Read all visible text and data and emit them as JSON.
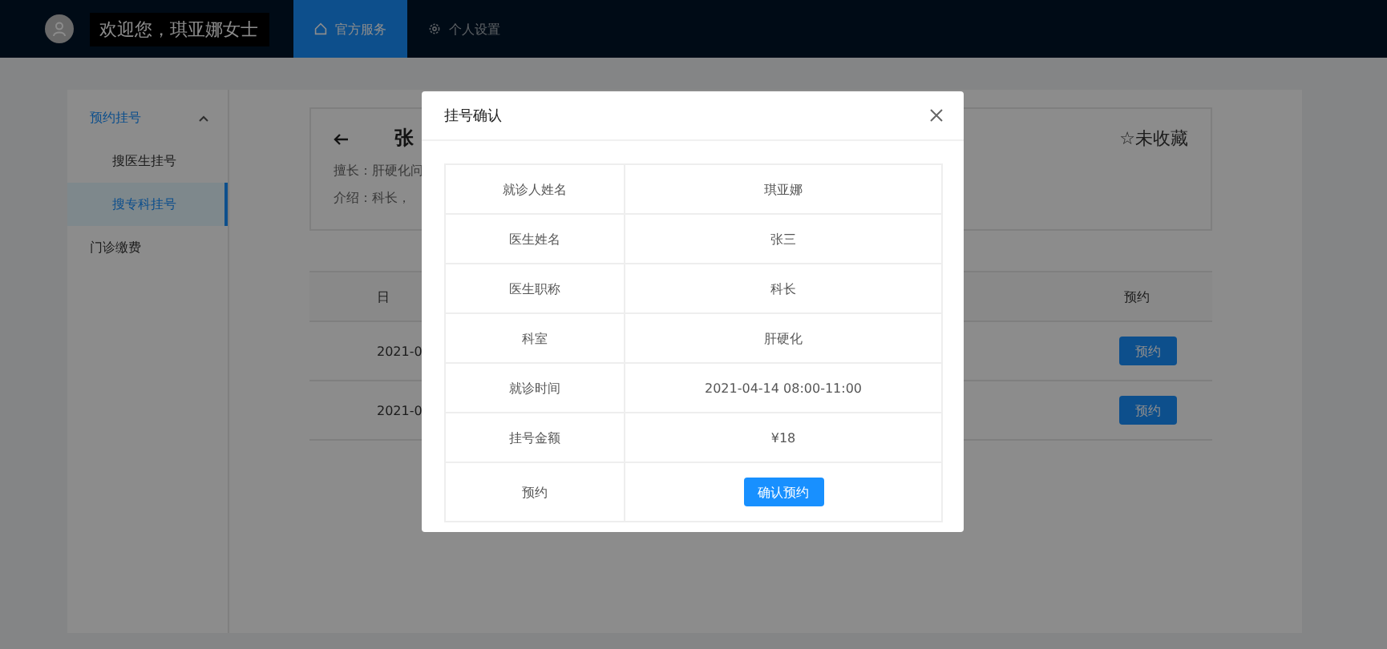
{
  "header": {
    "welcome": "欢迎您，琪亚娜女士",
    "nav": [
      {
        "label": "官方服务",
        "selected": true
      },
      {
        "label": "个人设置",
        "selected": false
      }
    ]
  },
  "sidebar": {
    "items": [
      {
        "label": "预约挂号",
        "expanded": true,
        "children": [
          {
            "label": "搜医生挂号",
            "selected": false
          },
          {
            "label": "搜专科挂号",
            "selected": true
          }
        ]
      },
      {
        "label": "门诊缴费",
        "expanded": false
      }
    ]
  },
  "doctor_card": {
    "name": "张",
    "specialty": "擅长：肝硬化问",
    "intro": "介绍：科长，",
    "favorite": "☆未收藏"
  },
  "schedule_table": {
    "columns": [
      "日",
      "预约"
    ],
    "rows": [
      {
        "date": "2021-0",
        "button": "预约"
      },
      {
        "date": "2021-0",
        "button": "预约"
      }
    ]
  },
  "modal": {
    "title": "挂号确认",
    "rows": [
      {
        "label": "就诊人姓名",
        "value": "琪亚娜"
      },
      {
        "label": "医生姓名",
        "value": "张三"
      },
      {
        "label": "医生职称",
        "value": "科长"
      },
      {
        "label": "科室",
        "value": "肝硬化"
      },
      {
        "label": "就诊时间",
        "value": "2021-04-14 08:00-11:00"
      },
      {
        "label": "挂号金额",
        "value": "¥18"
      },
      {
        "label": "预约",
        "button": "确认预约"
      }
    ]
  }
}
